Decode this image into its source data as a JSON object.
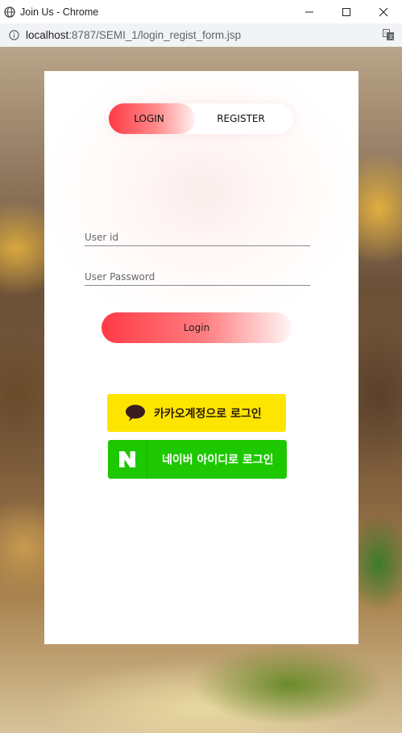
{
  "window": {
    "title": "Join Us - Chrome"
  },
  "address_bar": {
    "url_host": "localhost",
    "url_rest": ":8787/SEMI_1/login_regist_form.jsp"
  },
  "tabs": {
    "login_label": "LOGIN",
    "register_label": "REGISTER"
  },
  "form": {
    "user_id_placeholder": "User id",
    "password_placeholder": "User Password",
    "login_button_label": "Login"
  },
  "social": {
    "kakao_label": "카카오계정으로 로그인",
    "naver_label": "네이버 아이디로 로그인"
  },
  "colors": {
    "accent_red": "#ff3a45",
    "kakao_yellow": "#fee500",
    "naver_green": "#1ec800"
  },
  "icons": [
    "globe-icon",
    "minimize-icon",
    "maximize-icon",
    "close-icon",
    "info-icon",
    "translate-icon",
    "kakao-speech-icon",
    "naver-n-icon"
  ]
}
